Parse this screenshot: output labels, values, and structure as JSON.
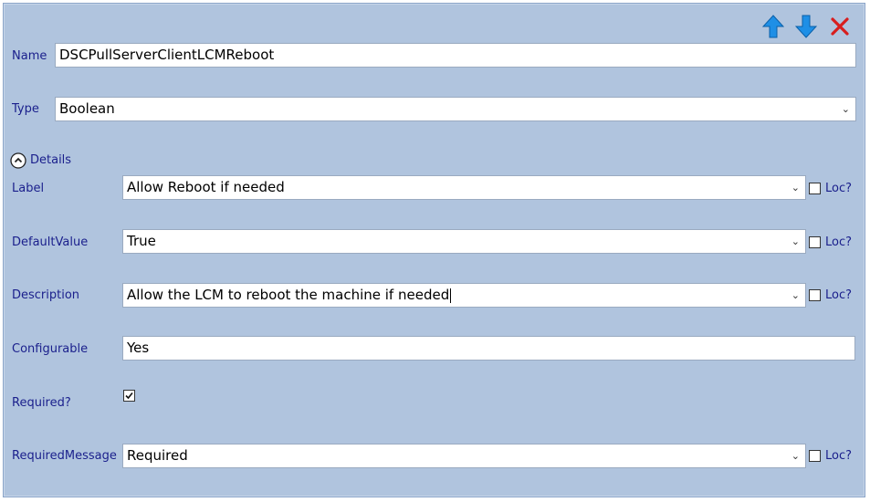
{
  "colors": {
    "panel": "#b0c4de",
    "label": "#1a1f8c",
    "arrow": "#1e8fe6",
    "delete": "#d81e1e"
  },
  "toolbar": {
    "up_icon": "arrow-up-icon",
    "down_icon": "arrow-down-icon",
    "delete_icon": "close-x-icon"
  },
  "name": {
    "label": "Name",
    "value": "DSCPullServerClientLCMReboot"
  },
  "type": {
    "label": "Type",
    "value": "Boolean"
  },
  "details": {
    "label": "Details",
    "icon": "chevron-up-circle-icon"
  },
  "label_field": {
    "label": "Label",
    "value": "Allow Reboot if needed",
    "loc": "Loc?"
  },
  "default_value": {
    "label": "DefaultValue",
    "value": "True",
    "loc": "Loc?"
  },
  "description": {
    "label": "Description",
    "value": "Allow the LCM to reboot the machine if needed",
    "loc": "Loc?"
  },
  "configurable": {
    "label": "Configurable",
    "value": "Yes"
  },
  "required": {
    "label": "Required?",
    "checked": true
  },
  "required_message": {
    "label": "RequiredMessage",
    "value": "Required",
    "loc": "Loc?"
  }
}
